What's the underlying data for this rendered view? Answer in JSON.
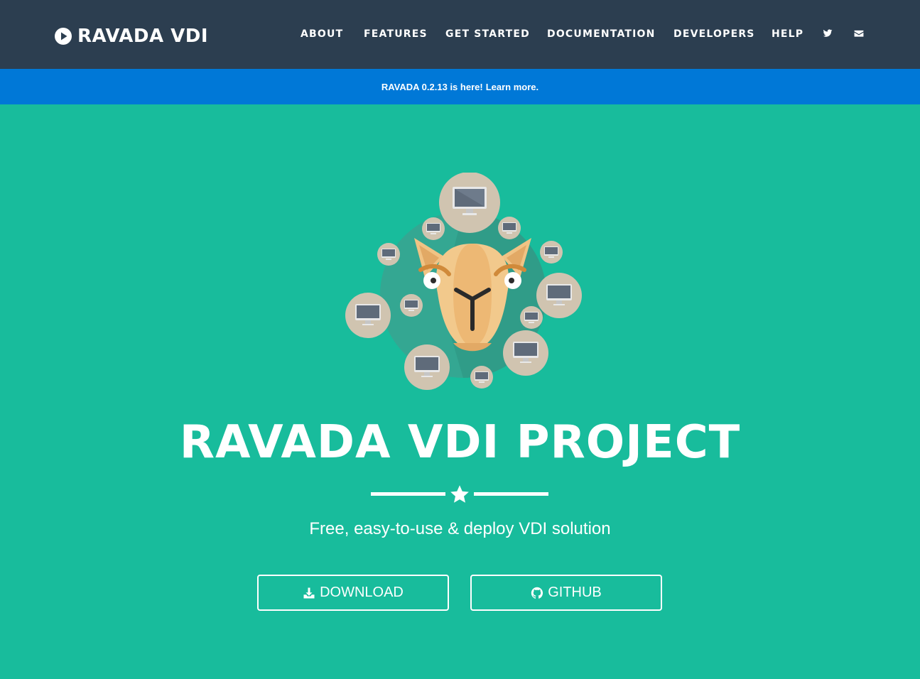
{
  "brand": {
    "name": "RAVADA VDI",
    "icon": "play-circle-icon"
  },
  "nav": {
    "items": [
      "ABOUT",
      "FEATURES",
      "GET STARTED",
      "DOCUMENTATION",
      "DEVELOPERS",
      "HELP"
    ],
    "icons": [
      "twitter-icon",
      "envelope-icon"
    ]
  },
  "announcement": {
    "text": "RAVADA 0.2.13 is here!",
    "link": "Learn more."
  },
  "hero": {
    "title": "RAVADA VDI PROJECT",
    "subtitle": "Free, easy-to-use & deploy VDI solution",
    "buttons": [
      {
        "label": "DOWNLOAD",
        "icon": "download-icon"
      },
      {
        "label": "GITHUB",
        "icon": "github-icon"
      }
    ]
  },
  "colors": {
    "navbar": "#2c3e50",
    "announcement": "#0078d7",
    "hero": "#18bc9c",
    "text": "#ffffff"
  }
}
